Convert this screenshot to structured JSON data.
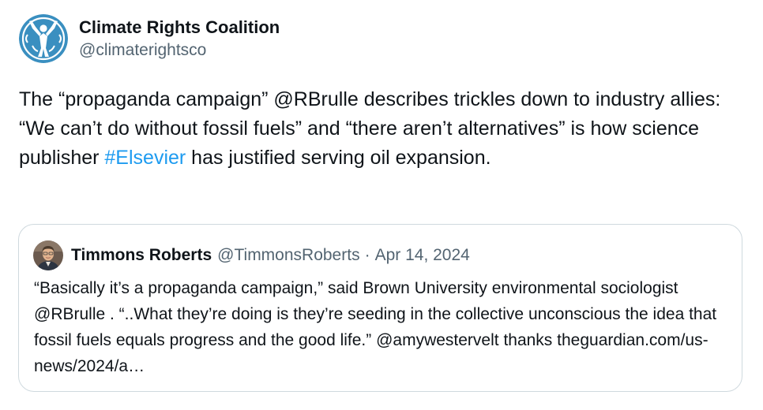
{
  "author": {
    "display_name": "Climate Rights Coalition",
    "handle": "@climaterightsco",
    "avatar_icon": "figure-arms-raised-circle-logo",
    "avatar_color": "#3a8fc0"
  },
  "tweet": {
    "text_before_hashtag": "The “propaganda campaign” @RBrulle describes trickles down to industry allies: “We can’t do without fossil fuels” and “there aren’t alternatives” is how science publisher ",
    "hashtag": "#Elsevier",
    "text_after_hashtag": " has justified serving oil expansion."
  },
  "quote": {
    "display_name": "Timmons Roberts",
    "handle": "@TimmonsRoberts",
    "separator": "·",
    "date": "Apr 14, 2024",
    "avatar_icon": "person-photo-avatar",
    "text": "“Basically it’s a propaganda campaign,” said Brown University environmental sociologist @RBrulle . “..What they’re doing is they’re seeding in the collective unconscious the idea that fossil fuels equals progress and the good life.” @amywestervelt thanks theguardian.com/us-news/2024/a…"
  },
  "colors": {
    "link": "#1d9bf0",
    "secondary_text": "#536471",
    "border": "#cfd9de"
  }
}
